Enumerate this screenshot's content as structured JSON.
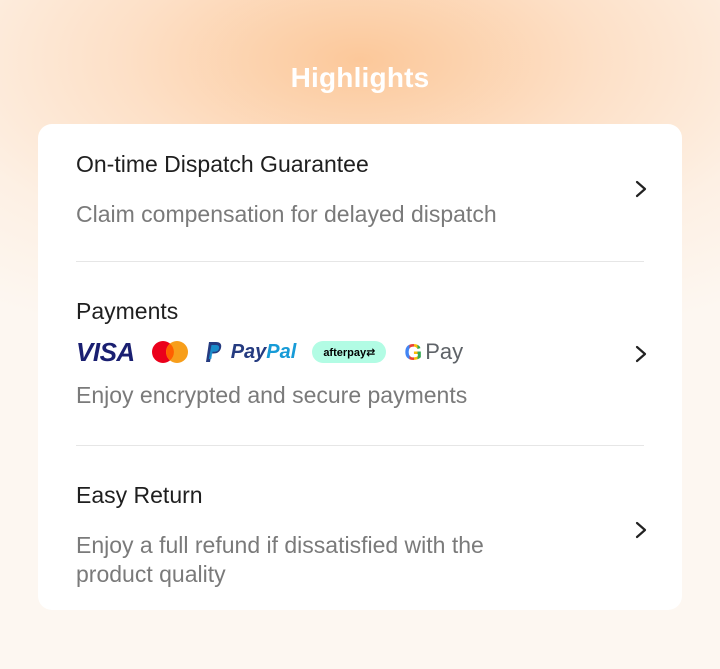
{
  "page": {
    "title": "Highlights"
  },
  "items": [
    {
      "title": "On-time Dispatch Guarantee",
      "description": "Claim compensation for delayed dispatch",
      "icon": "chevron-right-icon"
    },
    {
      "title": "Payments",
      "description": "Enjoy encrypted and secure payments",
      "icon": "chevron-right-icon",
      "payment_methods": {
        "visa": "VISA",
        "mastercard": "mastercard-logo",
        "paypal_pay": "Pay",
        "paypal_pal": "Pal",
        "afterpay": "afterpay⇄",
        "gpay_g": "G",
        "gpay_pay": "Pay"
      }
    },
    {
      "title": "Easy Return",
      "description_line1": "Enjoy a full refund if dissatisfied with the",
      "description_line2": "product quality",
      "icon": "chevron-right-icon"
    }
  ],
  "colors": {
    "accent_gradient": "#fcc89a",
    "card_background": "#ffffff",
    "title_text": "#1f1f1f",
    "description_text": "#7a7a7a",
    "divider": "#e6e6e6"
  }
}
